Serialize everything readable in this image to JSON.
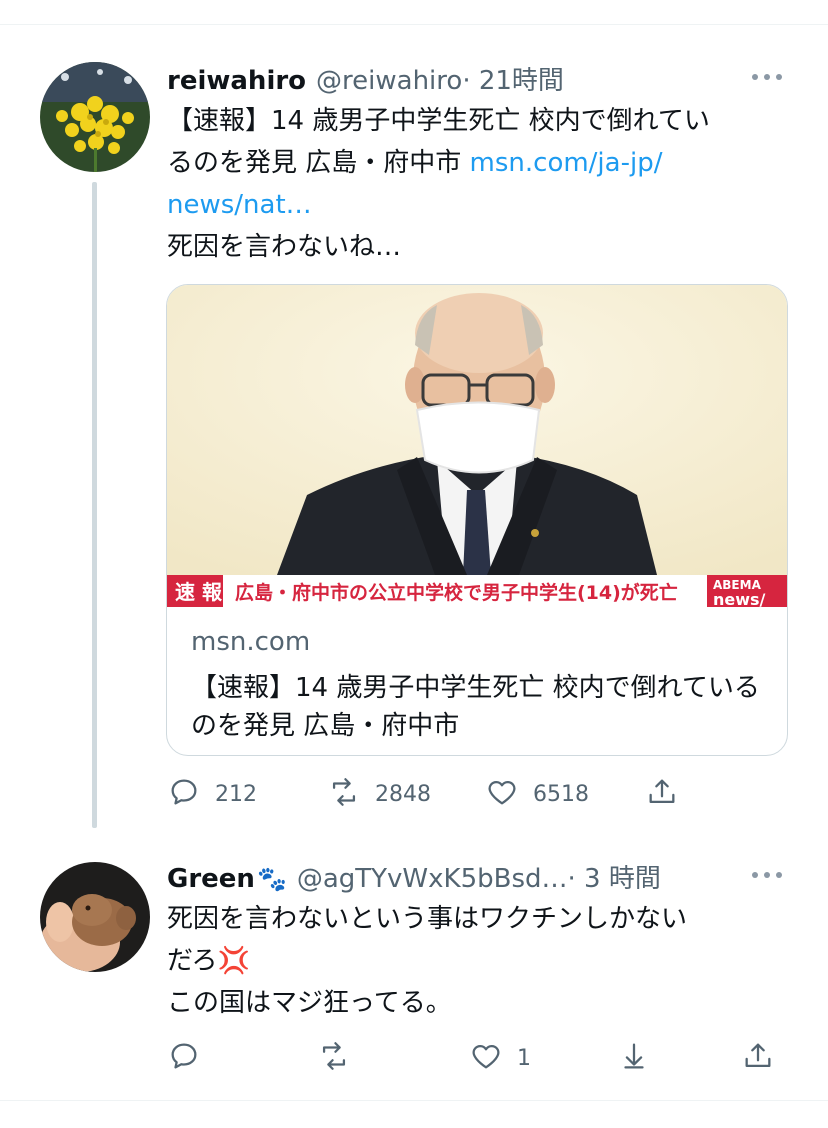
{
  "tweet1": {
    "display_name": "reiwahiro",
    "handle": "@reiwahiro",
    "time": "· 21時間",
    "text_line1": "【速報】14 歳男子中学生死亡 校内で倒れてい",
    "text_line2_plain": "るのを発見 広島・府中市 ",
    "text_link_part1": "msn.com/ja-jp/",
    "text_link_part2": "news/nat…",
    "text_comment": "死因を言わないね…",
    "card": {
      "banner_tag": "速 報",
      "banner_text": "広島・府中市の公立中学校で男子中学生(14)が死亡",
      "banner_logo_line1": "ABEMA",
      "banner_logo_line2": "news/",
      "domain": "msn.com",
      "title": "【速報】14 歳男子中学生死亡 校内で倒れているのを発見 広島・府中市"
    },
    "actions": {
      "reply_count": "212",
      "retweet_count": "2848",
      "like_count": "6518"
    }
  },
  "tweet2": {
    "display_name": "Green",
    "name_emoji": "🐾",
    "handle": "@agTYvWxK5bBsd…",
    "time": "· 3 時間",
    "text_line1": "死因を言わないという事はワクチンしかない",
    "text_line2": "だろ",
    "text_emoji": "💢",
    "text_line3": "この国はマジ狂ってる。",
    "actions": {
      "like_count": "1"
    }
  },
  "icons": {
    "reply": "reply-icon",
    "retweet": "retweet-icon",
    "like": "heart-icon",
    "share": "share-icon",
    "down": "download-icon",
    "more": "more-icon"
  },
  "colors": {
    "link": "#1d9bf0",
    "secondary_text": "#536471",
    "icon": "#536471",
    "banner_red": "#d6253f"
  }
}
